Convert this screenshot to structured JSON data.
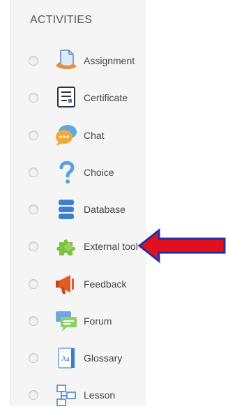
{
  "panel": {
    "title": "ACTIVITIES",
    "items": [
      {
        "label": "Assignment",
        "icon": "assignment-icon"
      },
      {
        "label": "Certificate",
        "icon": "certificate-icon"
      },
      {
        "label": "Chat",
        "icon": "chat-icon"
      },
      {
        "label": "Choice",
        "icon": "choice-icon"
      },
      {
        "label": "Database",
        "icon": "database-icon"
      },
      {
        "label": "External tool",
        "icon": "external-tool-icon"
      },
      {
        "label": "Feedback",
        "icon": "feedback-icon"
      },
      {
        "label": "Forum",
        "icon": "forum-icon"
      },
      {
        "label": "Glossary",
        "icon": "glossary-icon"
      },
      {
        "label": "Lesson",
        "icon": "lesson-icon"
      }
    ]
  },
  "annotation": {
    "arrow_color": "#e0101e",
    "arrow_outline": "#2330a8"
  }
}
